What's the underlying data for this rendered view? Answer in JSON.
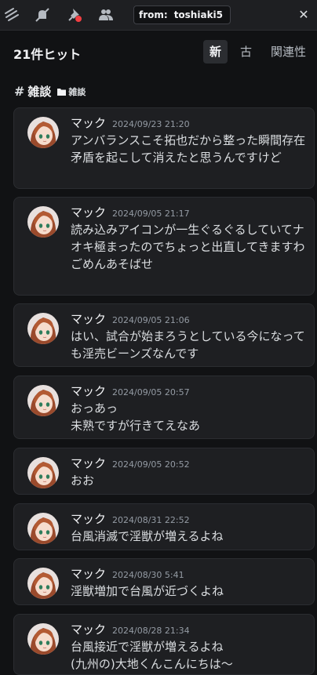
{
  "toolbar": {
    "icons": [
      "threads-icon",
      "mute-bell-icon",
      "pin-icon",
      "members-icon"
    ],
    "search_filter_key": "from:",
    "search_filter_value": "toshiaki5",
    "clear_label": "✕"
  },
  "results": {
    "hit_count": "21件ヒット",
    "sort_tabs": [
      "新",
      "古",
      "関連性"
    ],
    "active_sort": "新"
  },
  "channel": {
    "name": "雑談",
    "category": "雑談"
  },
  "messages": [
    {
      "author": "マック",
      "timestamp": "2024/09/23 21:20",
      "content": "アンバランスこそ拓也だから整った瞬間存在矛盾を起こして消えたと思うんですけど"
    },
    {
      "author": "マック",
      "timestamp": "2024/09/05 21:17",
      "content": "読み込みアイコンが一生ぐるぐるしていてナオキ極まったのでちょっと出直してきますわ\nごめんあそばせ"
    },
    {
      "author": "マック",
      "timestamp": "2024/09/05 21:06",
      "content": "はい、試合が始まろうとしている今になっても淫売ビーンズなんです"
    },
    {
      "author": "マック",
      "timestamp": "2024/09/05 20:57",
      "content": "おっあっ\n未熟ですが行きてえなあ"
    },
    {
      "author": "マック",
      "timestamp": "2024/09/05 20:52",
      "content": "おお"
    },
    {
      "author": "マック",
      "timestamp": "2024/08/31 22:52",
      "content": "台風消滅で淫獣が増えるよね"
    },
    {
      "author": "マック",
      "timestamp": "2024/08/30 5:41",
      "content": "淫獣増加で台風が近づくよね"
    },
    {
      "author": "マック",
      "timestamp": "2024/08/28 21:34",
      "content": "台風接近で淫獣が増えるよね\n(九州の)大地くんこんにちは〜"
    }
  ],
  "colors": {
    "background": "#111214",
    "card": "#1e1f22",
    "notification_dot": "#f23f43"
  }
}
